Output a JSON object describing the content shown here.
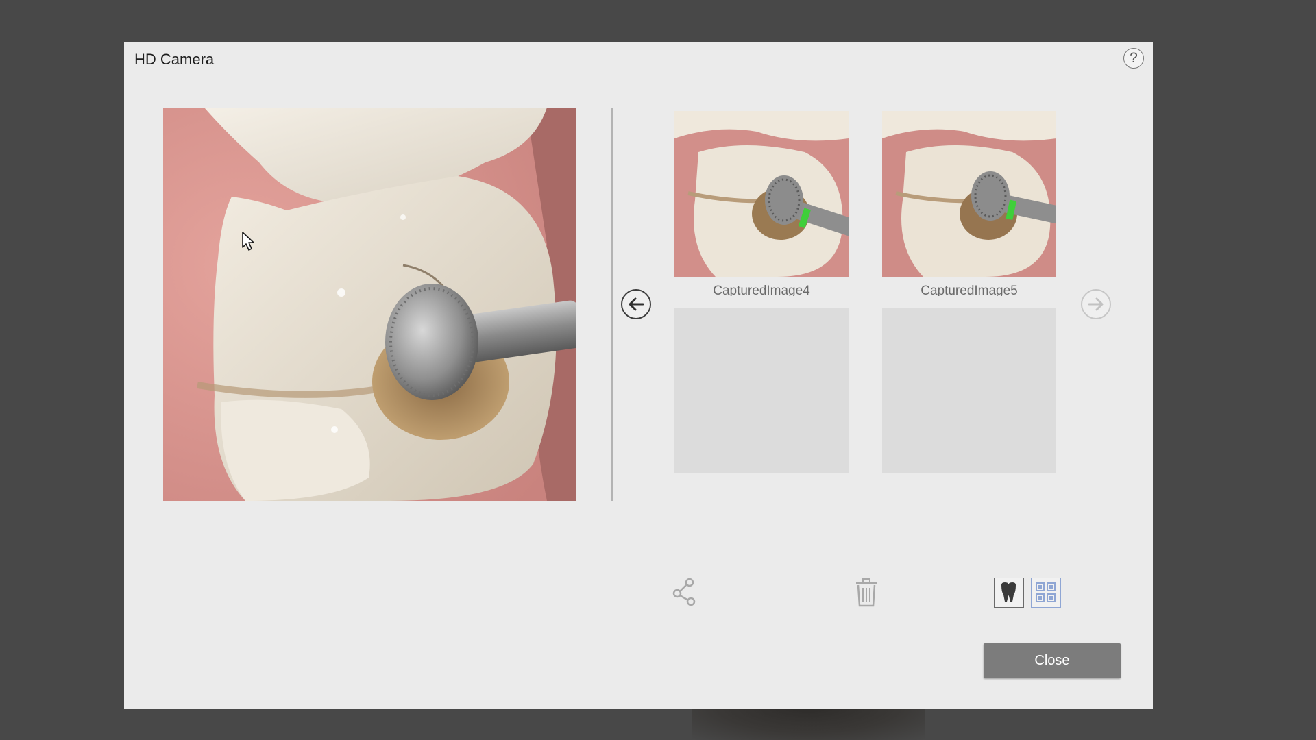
{
  "dialog": {
    "title": "HD Camera",
    "help_label": "?"
  },
  "gallery": {
    "thumbnails": [
      {
        "label": "CapturedImage4"
      },
      {
        "label": "CapturedImage5"
      }
    ],
    "empty_slots": 2
  },
  "icons": {
    "help": "question-icon",
    "prev": "arrow-left-icon",
    "next": "arrow-right-icon",
    "share": "share-icon",
    "delete": "trash-icon",
    "tooth_view": "tooth-icon",
    "grid_view": "grid-icon"
  },
  "footer": {
    "close_label": "Close"
  },
  "colors": {
    "dialog_bg": "#ebebeb",
    "backdrop": "#484848",
    "close_button": "#7c7c7c",
    "grid_icon_blue": "#8fa6d4",
    "bur_green": "#3fcf3a"
  }
}
